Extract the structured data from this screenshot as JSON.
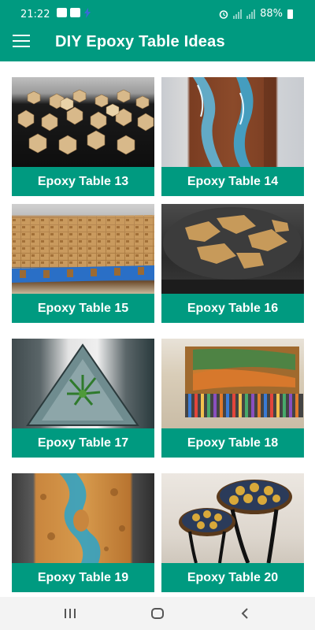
{
  "status": {
    "time": "21:22",
    "battery": "88%"
  },
  "app": {
    "title": "DIY Epoxy Table Ideas"
  },
  "cards": [
    {
      "label": "Epoxy Table 13"
    },
    {
      "label": "Epoxy Table 14"
    },
    {
      "label": "Epoxy Table 15"
    },
    {
      "label": "Epoxy Table 16"
    },
    {
      "label": "Epoxy Table 17"
    },
    {
      "label": "Epoxy Table 18"
    },
    {
      "label": "Epoxy Table 19"
    },
    {
      "label": "Epoxy Table 20"
    }
  ],
  "colors": {
    "accent": "#009a80",
    "navbar": "#f3f3f3"
  },
  "navbar": {
    "icons": [
      "recents-icon",
      "home-icon",
      "back-icon"
    ]
  }
}
